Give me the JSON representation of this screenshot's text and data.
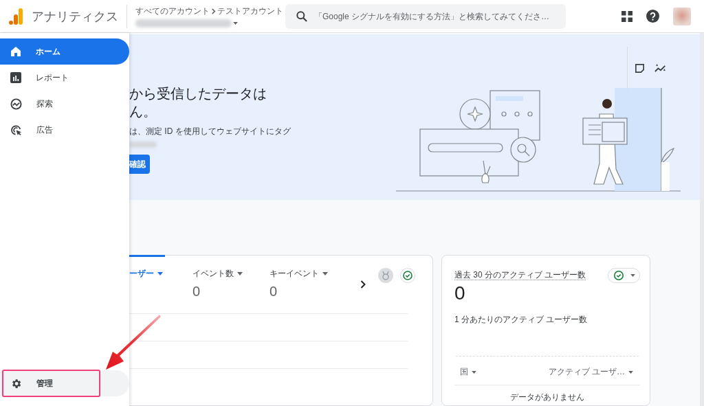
{
  "header": {
    "product": "アナリティクス",
    "breadcrumb": [
      "すべてのアカウント",
      "テストアカウント"
    ],
    "search": {
      "placeholder": "「Google シグナルを有効にする方法」と検索してみてくださ…"
    }
  },
  "sidebar": {
    "items": [
      {
        "label": "ホーム",
        "selected": true
      },
      {
        "label": "レポート",
        "selected": false
      },
      {
        "label": "探索",
        "selected": false
      },
      {
        "label": "広告",
        "selected": false
      }
    ],
    "footer": {
      "label": "管理",
      "selected": false
    }
  },
  "banner": {
    "heading_lines": [
      "から受信したデータは",
      "ん。"
    ],
    "body": "は、測定 ID を使用してウェブサイトにタグ",
    "button": "確認"
  },
  "metrics_card": {
    "metrics": [
      {
        "label": "ーザー",
        "selected": true
      },
      {
        "label": "イベント数",
        "value": "0",
        "selected": false
      },
      {
        "label": "キーイベント",
        "value": "0",
        "selected": false
      }
    ]
  },
  "realtime_card": {
    "title": "過去 30 分のアクティブ ユーザー数",
    "value": "0",
    "subtitle": "1 分あたりのアクティブ ユーザー数",
    "columns": [
      "国",
      "アクティブ ユーザ…"
    ],
    "empty": "データがありません"
  }
}
